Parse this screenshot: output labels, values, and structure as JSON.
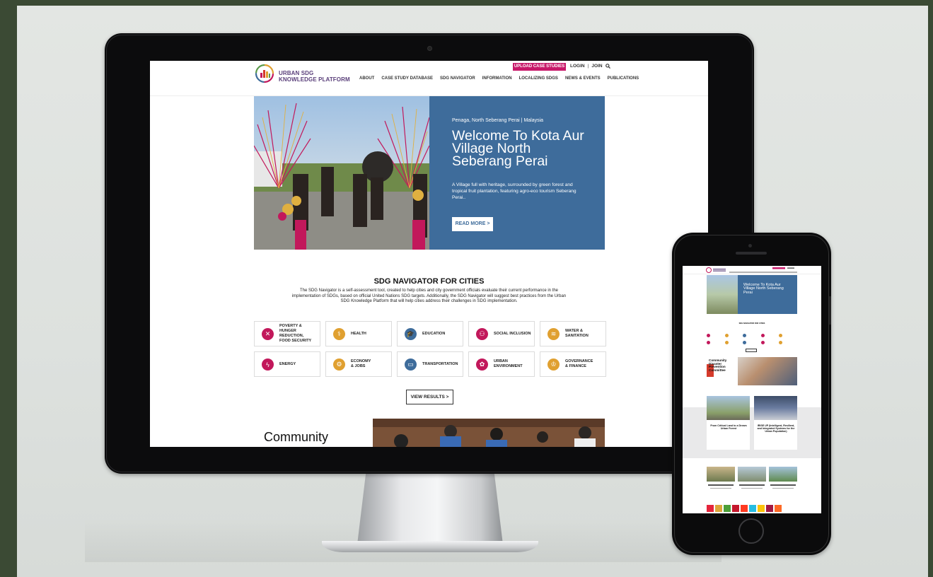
{
  "site": {
    "logo": {
      "line1": "URBAN SDG",
      "line2": "KNOWLEDGE PLATFORM"
    },
    "upload_label": "UPLOAD CASE STUDIES",
    "login_label": "LOGIN",
    "join_label": "JOIN",
    "auth_separator": "|",
    "nav": [
      "ABOUT",
      "CASE STUDY DATABASE",
      "SDG NAVIGATOR",
      "INFORMATION",
      "LOCALIZING SDGS",
      "NEWS & EVENTS",
      "PUBLICATIONS"
    ]
  },
  "hero": {
    "location": "Penaga, North Seberang Perai | Malaysia",
    "title": "Welcome To Kota Aur Village North Seberang Perai",
    "description": "A Village full with heritage, surrounded by green forest and tropical fruit plantation, featuring agro-eco tourism Seberang Perai..",
    "cta": "READ MORE >"
  },
  "navigator": {
    "title": "SDG NAVIGATOR FOR CITIES",
    "description": "The SDG Navigator is a self-assessment tool, created to help cities and city government officials evaluate their current performance in the implementation of SDGs, based on official United Nations SDG targets. Additionally, the SDG Navigator will suggest best practices from the Urban SDG Knowledge Platform that will help cities address their challenges in SDG implementation.",
    "cards": [
      {
        "label": "POVERTY &\nHUNGER REDUCTION,\nFOOD SECURITY",
        "icon": "fork-knife-icon",
        "color": "#c2185b",
        "glyph": "✕"
      },
      {
        "label": "HEALTH",
        "icon": "health-icon",
        "color": "#e0a030",
        "glyph": "⚕"
      },
      {
        "label": "EDUCATION",
        "icon": "graduation-cap-icon",
        "color": "#3e6c9b",
        "glyph": "🎓"
      },
      {
        "label": "SOCIAL INCLUSION",
        "icon": "people-icon",
        "color": "#c2185b",
        "glyph": "⚇"
      },
      {
        "label": "WATER &\nSANITATION",
        "icon": "water-icon",
        "color": "#e0a030",
        "glyph": "≋"
      },
      {
        "label": "ENERGY",
        "icon": "energy-icon",
        "color": "#c2185b",
        "glyph": "ϟ"
      },
      {
        "label": "ECONOMY\n& JOBS",
        "icon": "economy-icon",
        "color": "#e0a030",
        "glyph": "⚙"
      },
      {
        "label": "TRANSPORTATION",
        "icon": "bus-icon",
        "color": "#3e6c9b",
        "glyph": "▭"
      },
      {
        "label": "URBAN\nENVIRONMENT",
        "icon": "environment-icon",
        "color": "#c2185b",
        "glyph": "✿"
      },
      {
        "label": "GOVERNANCE\n& FINANCE",
        "icon": "governance-icon",
        "color": "#e0a030",
        "glyph": "♔"
      }
    ],
    "view_results": "VIEW RESULTS  >"
  },
  "community": {
    "title": "Community"
  },
  "phone": {
    "hero_title": "Welcome To Kota Aur Village North Seberang Perai",
    "community_title": "Community Disaster Prevention Committee",
    "featured": [
      {
        "title": "From Critical Land to a Dream Urban Forest"
      },
      {
        "title": "IRISE UP (Intelligent, Resilient, and Integrated Systems for the Urban Population)"
      }
    ]
  },
  "colors": {
    "brand_purple": "#5a3f7a",
    "accent_magenta": "#c8196a",
    "hero_blue": "#3e6c9b",
    "sdg_orange": "#e0a030"
  }
}
